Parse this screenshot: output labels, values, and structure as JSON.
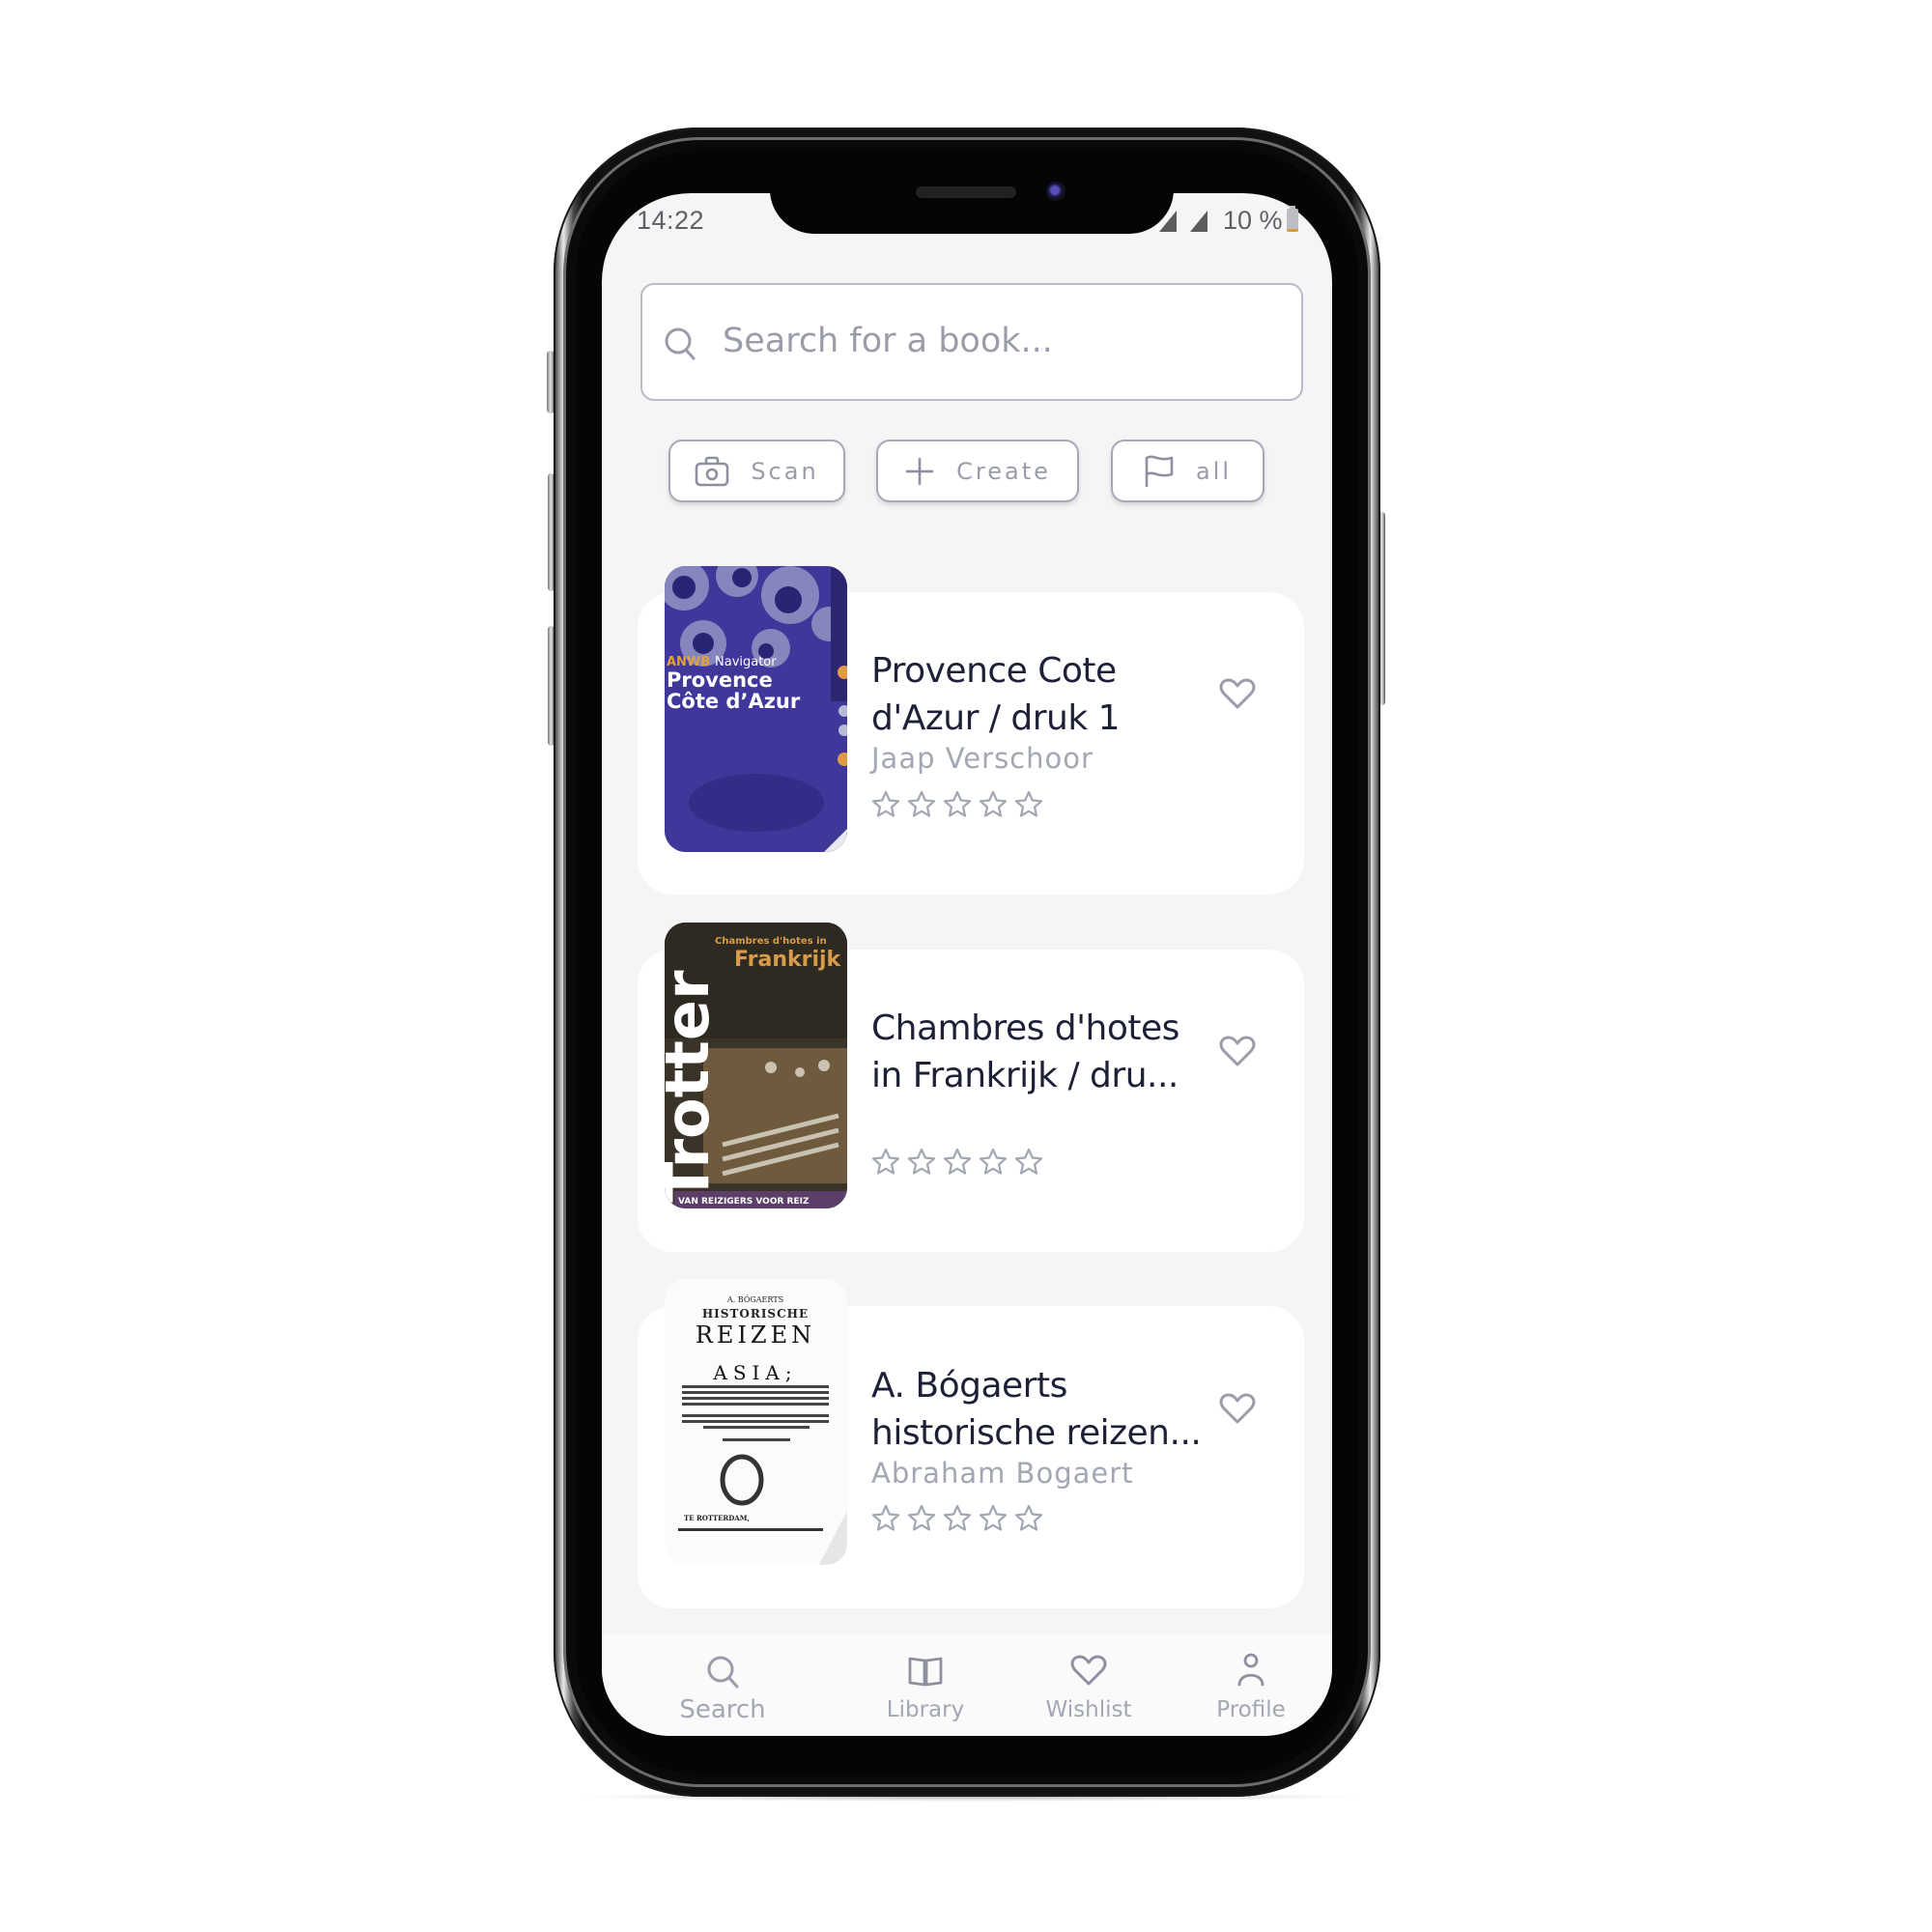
{
  "status_bar": {
    "time": "14:22",
    "battery_percent": "10 %",
    "battery_level": 0.1
  },
  "search": {
    "placeholder": "Search for a book...",
    "value": "",
    "icon": "search-icon"
  },
  "actions": [
    {
      "label": "Scan",
      "icon": "camera-icon"
    },
    {
      "label": "Create",
      "icon": "plus-icon"
    },
    {
      "label": "all",
      "icon": "flag-icon"
    }
  ],
  "books": [
    {
      "title": "Provence Cote d'Azur / druk 1",
      "title_display_line1": "Provence Cote",
      "title_display_line2": "d'Azur / druk 1",
      "author": "Jaap Verschoor",
      "rating": 0,
      "rating_max": 5,
      "favorite": false,
      "cover": {
        "publisher_label": "ANWB",
        "series": "Navigator",
        "title_line1": "Provence",
        "title_line2": "Côte d’Azur",
        "spine": "navigator",
        "color": "#3f389a"
      }
    },
    {
      "title": "Chambres d'hotes in Frankrijk / dru...",
      "title_display_line1": "Chambres d'hotes",
      "title_display_line2": "in Frankrijk / dru...",
      "author": "",
      "rating": 0,
      "rating_max": 5,
      "favorite": false,
      "cover": {
        "brand": "Trotter",
        "subtitle": "Chambres d'hotes in",
        "title": "Frankrijk",
        "footer": "VAN REIZIGERS VOOR REIZ",
        "color": "#3a3428"
      }
    },
    {
      "title": "A. Bógaerts historische reizen...",
      "title_display_line1": "A. Bógaerts",
      "title_display_line2": "historische reizen...",
      "author": "Abraham Bogaert",
      "rating": 0,
      "rating_max": 5,
      "favorite": false,
      "cover": {
        "line1": "A. BÓGAERTS",
        "line2": "HISTORISCHE",
        "line3": "REIZEN",
        "line4": "ASIA;",
        "footer": "TE ROTTERDAM,",
        "color": "#ffffff"
      }
    }
  ],
  "bottom_nav": [
    {
      "label": "Search",
      "icon": "search-icon",
      "active": true
    },
    {
      "label": "Library",
      "icon": "book-icon",
      "active": false
    },
    {
      "label": "Wishlist",
      "icon": "heart-icon",
      "active": false
    },
    {
      "label": "Profile",
      "icon": "user-icon",
      "active": false
    }
  ],
  "colors": {
    "background": "#f5f5f5",
    "title_text": "#1e2038",
    "muted_text": "#a3a7b3",
    "border": "#b9bbc6",
    "icon": "#9a9ca9"
  }
}
